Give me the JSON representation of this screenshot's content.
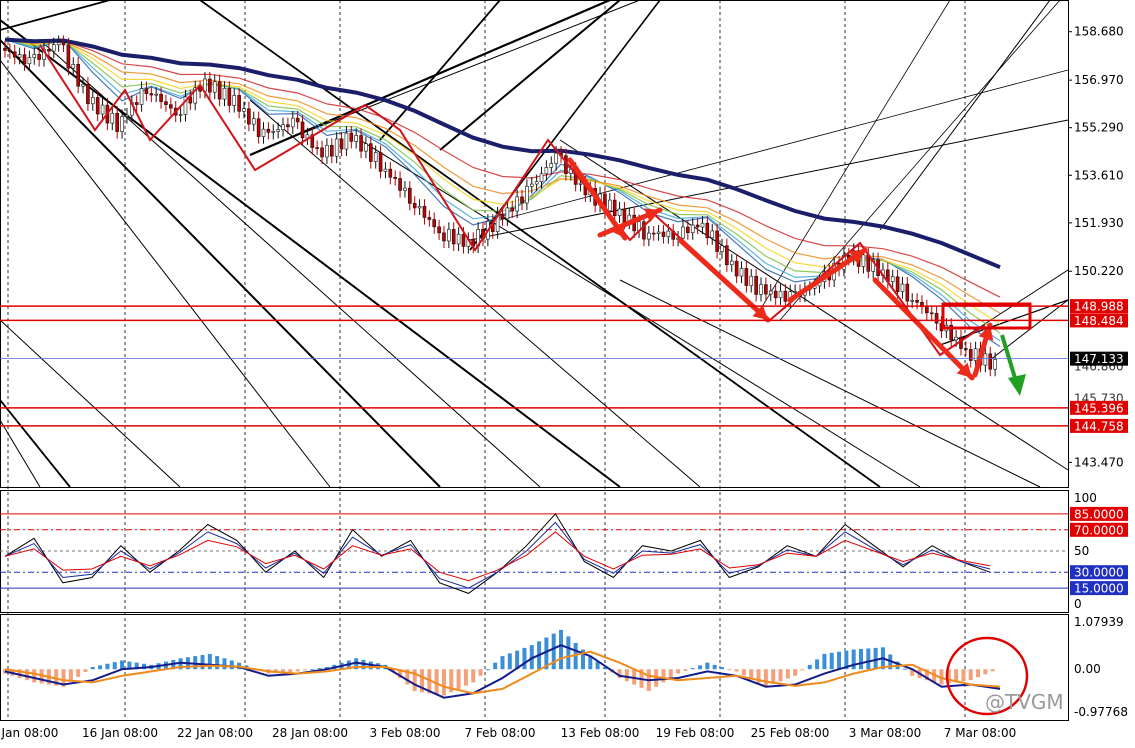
{
  "chart_data": [
    {
      "type": "candlestick",
      "panel": "price",
      "y_ticks": [
        "158.680",
        "156.970",
        "155.290",
        "153.610",
        "151.930",
        "150.220",
        "143.470"
      ],
      "ylim": [
        142.6,
        159.8
      ],
      "price_labels": [
        {
          "value": "148.988",
          "color": "#e00000"
        },
        {
          "value": "148.484",
          "color": "#e00000"
        },
        {
          "value": "147.133",
          "color": "#000000"
        },
        {
          "value": "145.396",
          "color": "#e00000"
        },
        {
          "value": "144.758",
          "color": "#e00000"
        }
      ],
      "partial_labels": [
        "146.860",
        "145.730"
      ],
      "horizontal_levels": [
        148.988,
        148.484,
        145.396,
        144.758
      ],
      "current_price": 147.133,
      "ma_ribbon": {
        "colors": [
          "#1b1f6b",
          "#d0282a",
          "#f08a1c",
          "#f5d21c",
          "#7bc143",
          "#3aa8d8",
          "#2a5fb0"
        ]
      },
      "close_path": [
        158.1,
        157.6,
        158.3,
        156.3,
        155.4,
        156.7,
        155.8,
        156.9,
        156.2,
        155.0,
        155.5,
        154.3,
        155.0,
        154.0,
        152.8,
        151.6,
        151.2,
        152.0,
        153.0,
        154.3,
        153.0,
        152.4,
        151.6,
        151.5,
        151.9,
        150.4,
        149.5,
        149.3,
        149.8,
        150.8,
        150.3,
        149.4,
        148.5,
        147.4,
        146.9
      ]
    },
    {
      "type": "line",
      "panel": "oscillator",
      "levels": [
        "85.0000",
        "70.0000",
        "30.0000",
        "15.0000"
      ],
      "axis_labels": [
        "100",
        "50",
        "0"
      ],
      "ylim": [
        0,
        100
      ],
      "series": [
        {
          "color": "#000000",
          "values": [
            45,
            62,
            20,
            25,
            55,
            30,
            50,
            75,
            60,
            30,
            50,
            25,
            70,
            45,
            60,
            20,
            10,
            30,
            55,
            85,
            40,
            25,
            55,
            50,
            60,
            25,
            35,
            55,
            45,
            75,
            55,
            35,
            55,
            40,
            30
          ]
        },
        {
          "color": "#1a2aa0",
          "values": [
            45,
            57,
            25,
            28,
            50,
            33,
            48,
            68,
            57,
            34,
            48,
            29,
            63,
            46,
            56,
            24,
            15,
            30,
            50,
            77,
            42,
            29,
            50,
            48,
            56,
            29,
            36,
            51,
            45,
            68,
            52,
            37,
            51,
            40,
            33
          ]
        },
        {
          "color": "#e00000",
          "values": [
            45,
            52,
            32,
            33,
            45,
            36,
            46,
            60,
            54,
            38,
            46,
            33,
            55,
            46,
            52,
            30,
            22,
            32,
            46,
            68,
            45,
            33,
            46,
            47,
            52,
            34,
            37,
            48,
            45,
            60,
            50,
            40,
            48,
            41,
            36
          ]
        }
      ]
    },
    {
      "type": "macd",
      "panel": "histogram",
      "y_ticks": [
        "1.07939",
        "0.00",
        "-0.97768"
      ],
      "ylim": [
        -0.97768,
        1.07939
      ],
      "histogram": [
        -0.1,
        -0.3,
        -0.4,
        0.05,
        0.2,
        0.1,
        0.25,
        0.35,
        0.15,
        -0.1,
        -0.05,
        0.05,
        0.25,
        0.1,
        -0.5,
        -0.6,
        -0.3,
        0.3,
        0.55,
        0.9,
        0.3,
        -0.2,
        -0.5,
        -0.1,
        0.15,
        -0.05,
        -0.4,
        -0.15,
        0.35,
        0.45,
        0.5,
        -0.15,
        -0.35,
        -0.25,
        0.02
      ],
      "macd_line": [
        -0.05,
        -0.2,
        -0.35,
        -0.25,
        0.0,
        0.05,
        0.15,
        0.1,
        0.05,
        -0.15,
        -0.1,
        0.0,
        0.15,
        0.05,
        -0.35,
        -0.65,
        -0.55,
        -0.2,
        0.25,
        0.55,
        0.3,
        -0.15,
        -0.25,
        -0.2,
        -0.05,
        -0.15,
        -0.4,
        -0.35,
        -0.1,
        0.1,
        0.25,
        0.0,
        -0.4,
        -0.35,
        -0.45
      ],
      "signal_line": [
        0.0,
        -0.1,
        -0.25,
        -0.3,
        -0.15,
        -0.05,
        0.05,
        0.08,
        0.06,
        -0.05,
        -0.1,
        -0.05,
        0.05,
        0.05,
        -0.1,
        -0.4,
        -0.55,
        -0.45,
        -0.1,
        0.25,
        0.4,
        0.15,
        -0.15,
        -0.25,
        -0.2,
        -0.15,
        -0.28,
        -0.38,
        -0.3,
        -0.1,
        0.05,
        0.1,
        -0.2,
        -0.35,
        -0.4
      ]
    }
  ],
  "x_tick_labels": [
    "Jan 08:00",
    "16 Jan 08:00",
    "22 Jan 08:00",
    "28 Jan 08:00",
    "3 Feb 08:00",
    "7 Feb 08:00",
    "13 Feb 08:00",
    "19 Feb 08:00",
    "25 Feb 08:00",
    "3 Mar 08:00",
    "7 Mar 08:00"
  ],
  "watermark": "@TVGM",
  "colors": {
    "level_red": "#e00000",
    "up_arrow": "#ee2a1a",
    "down_arrow_green": "#22a022",
    "macd_pos": "#3a8fd6",
    "macd_neg": "#f4a07a"
  }
}
